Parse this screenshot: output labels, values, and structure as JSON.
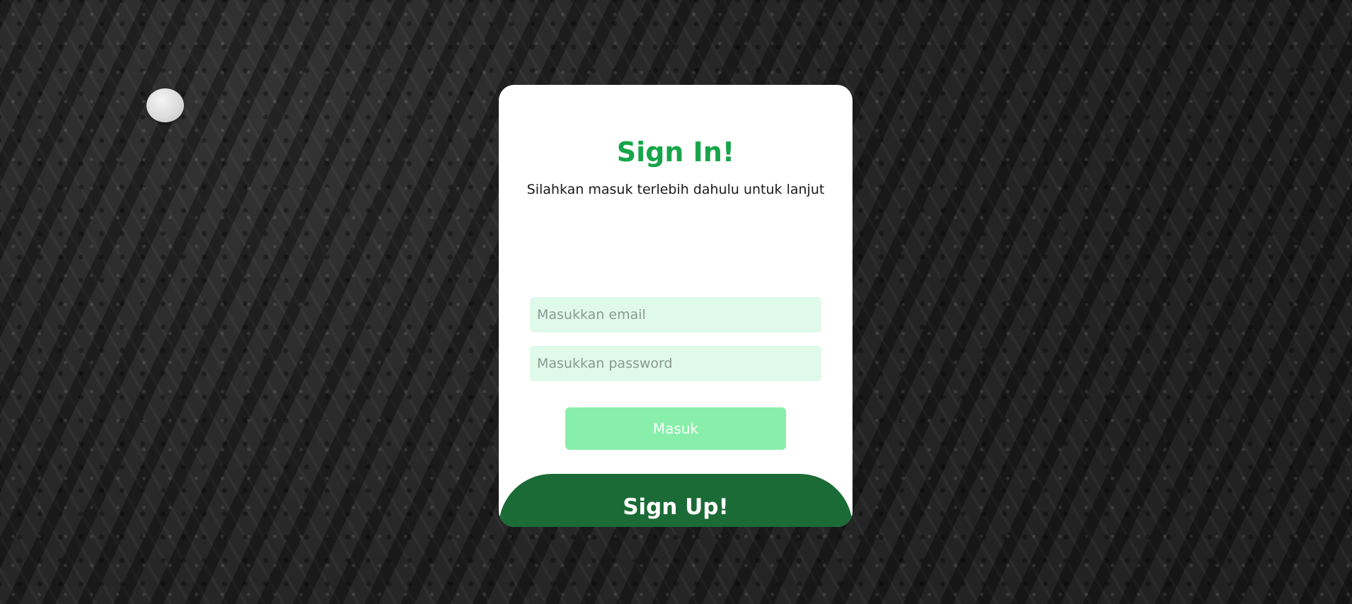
{
  "login": {
    "title": "Sign In!",
    "subtitle": "Silahkan masuk terlebih dahulu untuk lanjut",
    "email_placeholder": "Masukkan email",
    "password_placeholder": "Masukkan password",
    "submit_label": "Masuk",
    "signup_label": "Sign Up!"
  },
  "colors": {
    "title": "#17a54a",
    "input_bg": "#dff9ea",
    "submit_bg": "#88efaa",
    "signup_bg": "#1b6b36"
  }
}
